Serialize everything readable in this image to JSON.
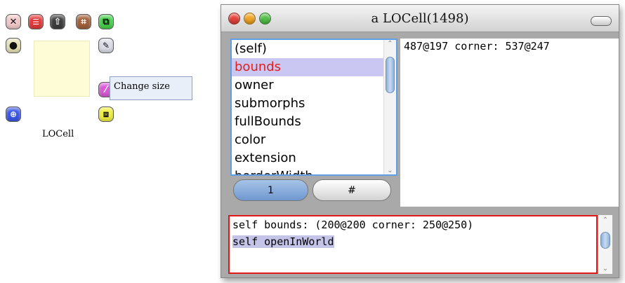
{
  "halo": {
    "buttons": [
      {
        "icon": "close-icon",
        "glyph": "✕",
        "color": "#f2c9c9"
      },
      {
        "icon": "menu-icon",
        "glyph": "☰",
        "color": "#e23a3a"
      },
      {
        "icon": "pick-up-icon",
        "glyph": "⇧",
        "color": "#3e3e3e"
      },
      {
        "icon": "move-icon",
        "glyph": "⌗",
        "color": "#a0603a"
      },
      {
        "icon": "duplicate-icon",
        "glyph": "⧉",
        "color": "#46d24a"
      },
      {
        "icon": "debug-icon",
        "glyph": "●",
        "color": "#e6e2b4"
      },
      {
        "icon": "wrench-icon",
        "glyph": "🔧",
        "color": "#dcdde8"
      },
      {
        "icon": "color-change-icon",
        "glyph": "⁄",
        "color": "#d85ad8"
      },
      {
        "icon": "rotate-icon",
        "glyph": "⊕",
        "color": "#3a56e6"
      },
      {
        "icon": "resize-icon",
        "glyph": "⧈",
        "color": "#f1f040"
      }
    ],
    "morph_name": "LOCell",
    "tooltip": "Change size"
  },
  "window": {
    "title": "a LOCell(1498)",
    "fields": [
      "(self)",
      "bounds",
      "owner",
      "submorphs",
      "fullBounds",
      "color",
      "extension",
      "borderWidth"
    ],
    "selected_field": "bounds",
    "tab1_label": "1",
    "tab2_label": "#",
    "value_text": "487@197 corner: 537@247",
    "eval_lines": [
      "self bounds: (200@200 corner: 250@250)",
      "self openInWorld"
    ]
  },
  "colors": {
    "selection_text": "#e0201e",
    "selection_bg": "#cac8f2",
    "list_focus_border": "#5f9fe6",
    "eval_border": "#e01818"
  }
}
